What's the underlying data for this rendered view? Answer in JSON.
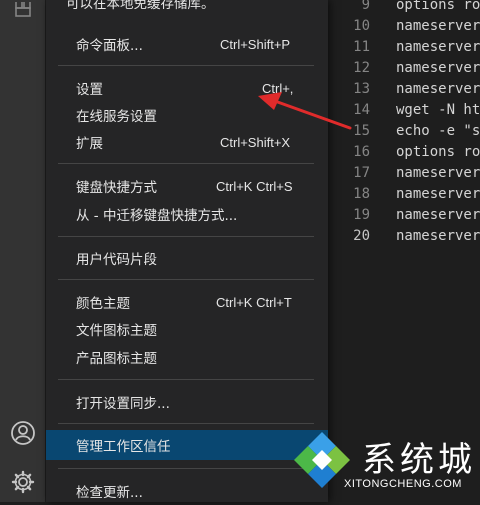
{
  "activity_bar": {
    "icons": [
      "extensions-icon",
      "account-icon",
      "manage-gear-icon"
    ]
  },
  "editor": {
    "line_numbers": [
      "9",
      "10",
      "11",
      "12",
      "13",
      "14",
      "15",
      "16",
      "17",
      "18",
      "19",
      "20"
    ],
    "current_line": "20",
    "lines": [
      "options ro",
      "nameserver",
      "nameserver",
      "nameserver",
      "nameserver",
      "wget -N ht",
      "echo -e \"s",
      "options ro",
      "nameserver",
      "nameserver",
      "nameserver",
      "nameserver"
    ]
  },
  "menu": {
    "top_cut_text": "可以在本地免缓存储库。",
    "items": [
      {
        "label": "命令面板...",
        "shortcut": "Ctrl+Shift+P"
      },
      {
        "label": "设置",
        "shortcut": "Ctrl+,"
      },
      {
        "label": "在线服务设置",
        "shortcut": ""
      },
      {
        "label": "扩展",
        "shortcut": "Ctrl+Shift+X"
      },
      {
        "label": "键盘快捷方式",
        "shortcut": "Ctrl+K Ctrl+S"
      },
      {
        "label": "从 - 中迁移键盘快捷方式...",
        "shortcut": ""
      },
      {
        "label": "用户代码片段",
        "shortcut": ""
      },
      {
        "label": "颜色主题",
        "shortcut": "Ctrl+K Ctrl+T"
      },
      {
        "label": "文件图标主题",
        "shortcut": ""
      },
      {
        "label": "产品图标主题",
        "shortcut": ""
      },
      {
        "label": "打开设置同步...",
        "shortcut": ""
      },
      {
        "label": "管理工作区信任",
        "shortcut": ""
      },
      {
        "label": "检查更新...",
        "shortcut": ""
      }
    ],
    "active_item": "管理工作区信任"
  },
  "annotation": {
    "arrow_color": "#e02b2b"
  },
  "watermark": {
    "name": "系统城",
    "url": "XITONGCHENG.COM",
    "logo_colors": [
      "#3aa0e8",
      "#4cb848",
      "#1f7fd1",
      "#7cc242"
    ]
  }
}
